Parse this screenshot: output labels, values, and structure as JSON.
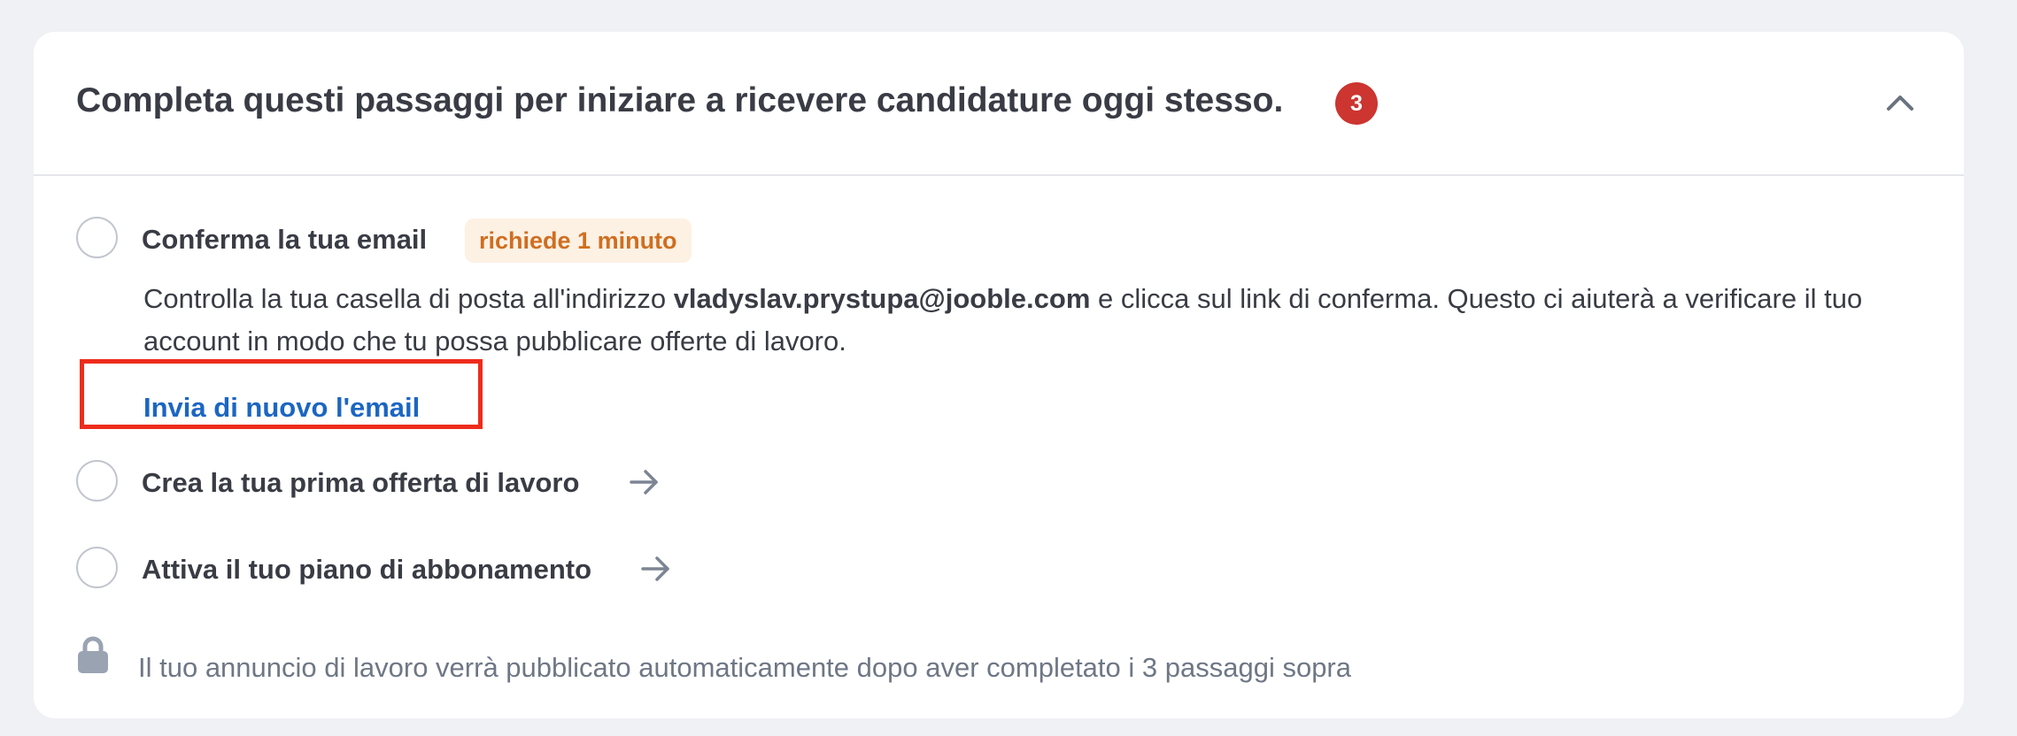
{
  "header": {
    "title": "Completa questi passaggi per iniziare a ricevere candidature oggi stesso.",
    "badge_count": "3",
    "toggle_icon": "chevron-up-icon"
  },
  "steps": [
    {
      "title": "Conferma la tua email",
      "badge": "richiede 1 minuto",
      "description": {
        "before": "Controlla la tua casella di posta all'indirizzo ",
        "email": "vladyslav.prystupa@jooble.com",
        "after": " e clicca sul link di conferma. Questo ci aiuterà a verificare il tuo account in modo che tu possa pubblicare offerte di lavoro."
      },
      "link": "Invia di nuovo l'email"
    },
    {
      "title": "Crea la tua prima offerta di lavoro",
      "icon": "arrow-right-icon"
    },
    {
      "title": "Attiva il tuo piano di abbonamento",
      "icon": "arrow-right-icon"
    }
  ],
  "footer": {
    "icon": "lock-icon",
    "note": "Il tuo annuncio di lavoro verrà pubblicato automaticamente dopo aver completato i 3 passaggi sopra"
  },
  "colors": {
    "page_background": "#f0f1f5",
    "card_background": "#ffffff",
    "text_primary": "#393c44",
    "text_muted": "#6e7785",
    "badge_red": "#cc3530",
    "time_badge_bg": "#fdf1e4",
    "time_badge_text": "#cf6e20",
    "link_blue": "#1c66c2",
    "highlight_red": "#ee2c1c"
  }
}
